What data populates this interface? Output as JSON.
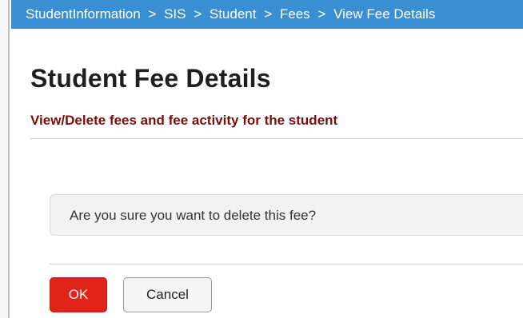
{
  "breadcrumb": {
    "items": [
      "StudentInformation",
      "SIS",
      "Student",
      "Fees"
    ],
    "separator": ">",
    "current": "View Fee Details"
  },
  "page": {
    "title": "Student Fee Details",
    "subtitle": "View/Delete fees and fee activity for the student"
  },
  "confirm": {
    "message": "Are you sure you want to delete this fee?"
  },
  "buttons": {
    "ok_label": "OK",
    "cancel_label": "Cancel"
  },
  "colors": {
    "breadcrumb_bg": "#3a8fd3",
    "subtitle_text": "#7a0d0d",
    "ok_button_bg": "#e2231b"
  }
}
